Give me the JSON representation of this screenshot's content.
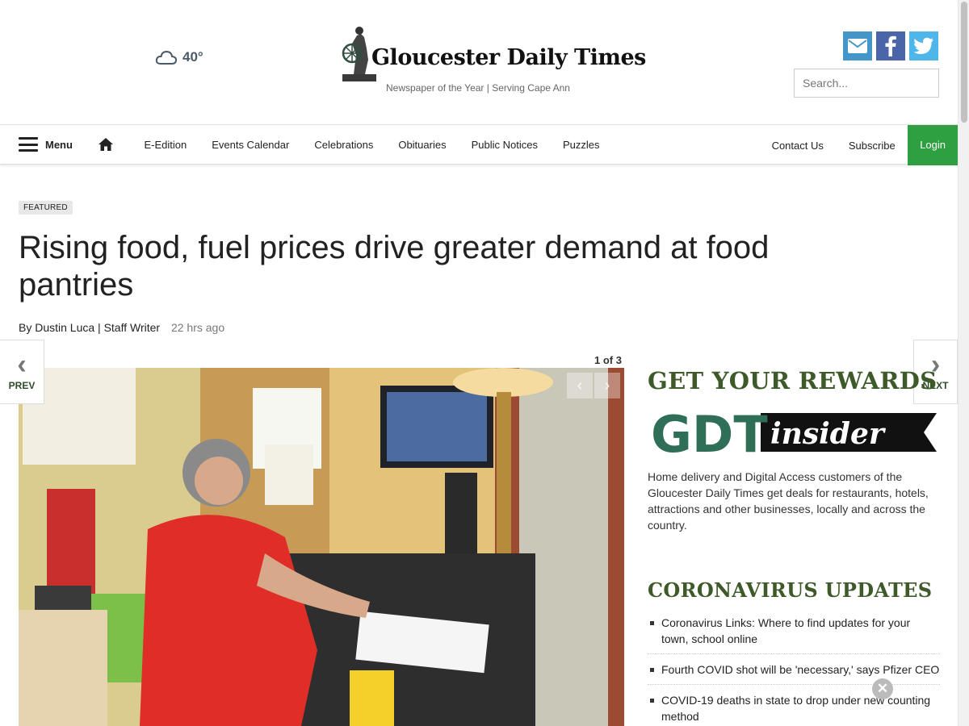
{
  "header": {
    "weather_temp": "40°",
    "weather_icon": "cloud-icon",
    "logo_title": "Gloucester Daily Times",
    "logo_tagline": "Newspaper of the Year | Serving Cape Ann",
    "search_placeholder": "Search...",
    "social": [
      "email-icon",
      "facebook-icon",
      "twitter-icon"
    ]
  },
  "nav": {
    "menu_label": "Menu",
    "links": [
      "E-Edition",
      "Events Calendar",
      "Celebrations",
      "Obituaries",
      "Public Notices",
      "Puzzles"
    ],
    "right_links": [
      "Contact Us",
      "Subscribe"
    ],
    "login_label": "Login"
  },
  "article": {
    "tag": "FEATURED",
    "headline": "Rising food, fuel prices drive greater demand at food pantries",
    "byline": "By Dustin Luca | Staff Writer",
    "timestamp": "22 hrs ago",
    "photo_count": "1 of 3"
  },
  "pager": {
    "prev": "PREV",
    "next": "NEXT"
  },
  "sidebar": {
    "rewards_heading": "GET YOUR REWARDS",
    "insider_logo": "GDT insider",
    "rewards_text": "Home delivery and Digital Access customers of the Gloucester Daily Times get deals for restaurants, hotels, attractions and other businesses, locally and across the country.",
    "corona_heading": "CORONAVIRUS UPDATES",
    "corona_items": [
      "Coronavirus Links: Where to find updates for your town, school online",
      "Fourth COVID shot will be 'necessary,' says Pfizer CEO",
      "COVID-19 deaths in state to drop under new counting method"
    ]
  },
  "colors": {
    "login_bg": "#2ea042",
    "sidebar_heading": "#3d5a28",
    "email": "#4596c8",
    "facebook": "#4a66a9",
    "twitter": "#4fb6e9"
  }
}
